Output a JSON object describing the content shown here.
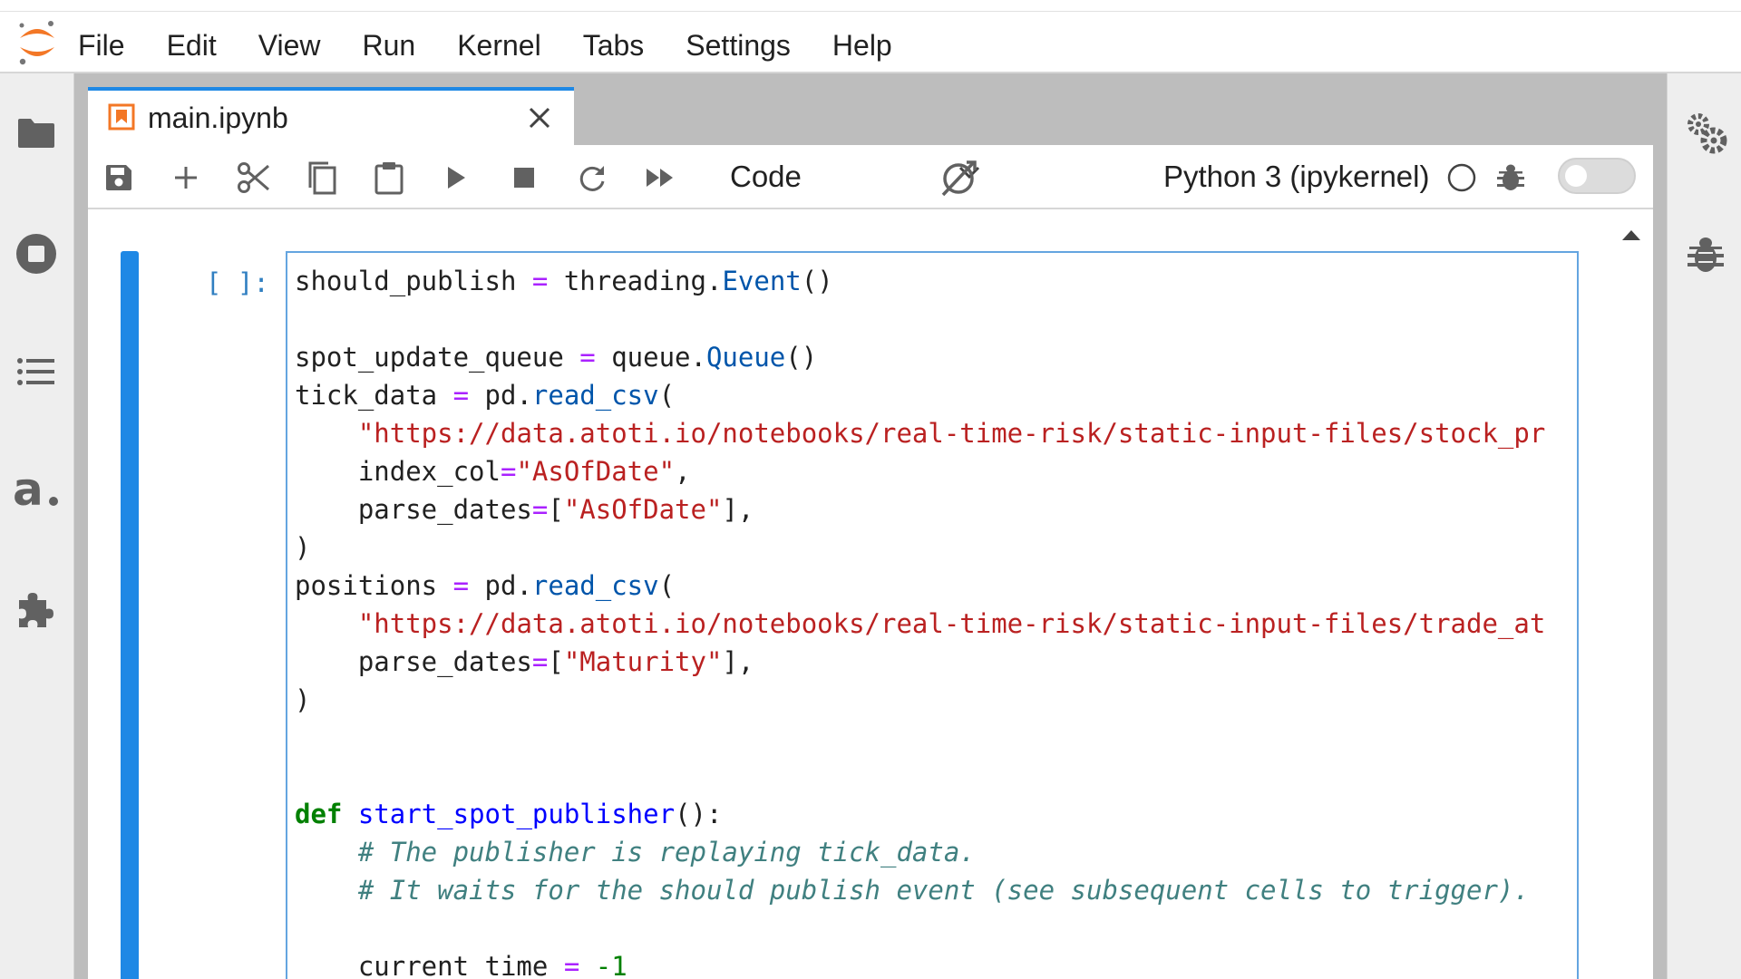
{
  "menu": {
    "items": [
      "File",
      "Edit",
      "View",
      "Run",
      "Kernel",
      "Tabs",
      "Settings",
      "Help"
    ]
  },
  "left_sidebar": {
    "icons": [
      "folder-icon",
      "running-stop-icon",
      "table-of-contents-icon",
      "atoti-icon",
      "extension-puzzle-icon"
    ]
  },
  "right_sidebar": {
    "icons": [
      "property-inspector-gears-icon",
      "debugger-bug-icon"
    ]
  },
  "tab": {
    "label": "main.ipynb"
  },
  "toolbar": {
    "cell_type": "Code",
    "kernel_name": "Python 3 (ipykernel)",
    "kernel_status": "idle",
    "debugger_enabled": false
  },
  "cell": {
    "prompt": "[ ]:",
    "lines": [
      [
        [
          "should_publish ",
          ""
        ],
        [
          "=",
          "op"
        ],
        [
          " threading.",
          ""
        ],
        [
          "Event",
          "fn"
        ],
        [
          "()",
          ""
        ]
      ],
      [],
      [
        [
          "spot_update_queue ",
          ""
        ],
        [
          "=",
          "op"
        ],
        [
          " queue.",
          ""
        ],
        [
          "Queue",
          "fn"
        ],
        [
          "()",
          ""
        ]
      ],
      [
        [
          "tick_data ",
          ""
        ],
        [
          "=",
          "op"
        ],
        [
          " pd.",
          ""
        ],
        [
          "read_csv",
          "fn"
        ],
        [
          "(",
          ""
        ]
      ],
      [
        [
          "    ",
          ""
        ],
        [
          "\"https://data.atoti.io/notebooks/real-time-risk/static-input-files/stock_pr",
          "str"
        ]
      ],
      [
        [
          "    index_col",
          ""
        ],
        [
          "=",
          "op"
        ],
        [
          "\"AsOfDate\"",
          "str"
        ],
        [
          ",",
          ""
        ]
      ],
      [
        [
          "    parse_dates",
          ""
        ],
        [
          "=",
          "op"
        ],
        [
          "[",
          ""
        ],
        [
          "\"AsOfDate\"",
          "str"
        ],
        [
          "],",
          ""
        ]
      ],
      [
        [
          ")",
          ""
        ]
      ],
      [
        [
          "positions ",
          ""
        ],
        [
          "=",
          "op"
        ],
        [
          " pd.",
          ""
        ],
        [
          "read_csv",
          "fn"
        ],
        [
          "(",
          ""
        ]
      ],
      [
        [
          "    ",
          ""
        ],
        [
          "\"https://data.atoti.io/notebooks/real-time-risk/static-input-files/trade_at",
          "str"
        ]
      ],
      [
        [
          "    parse_dates",
          ""
        ],
        [
          "=",
          "op"
        ],
        [
          "[",
          ""
        ],
        [
          "\"Maturity\"",
          "str"
        ],
        [
          "],",
          ""
        ]
      ],
      [
        [
          ")",
          ""
        ]
      ],
      [],
      [],
      [
        [
          "def",
          "kw"
        ],
        [
          " ",
          ""
        ],
        [
          "start_spot_publisher",
          "def"
        ],
        [
          "():",
          ""
        ]
      ],
      [
        [
          "    ",
          ""
        ],
        [
          "# The publisher is replaying tick_data.",
          "com"
        ]
      ],
      [
        [
          "    ",
          ""
        ],
        [
          "# It waits for the should publish event (see subsequent cells to trigger).",
          "com"
        ]
      ],
      [],
      [
        [
          "    current_time ",
          ""
        ],
        [
          "=",
          "op"
        ],
        [
          " ",
          ""
        ],
        [
          "-1",
          "num"
        ]
      ]
    ]
  },
  "colors": {
    "accent": "#1e88e5",
    "string": "#ba2121",
    "keyword": "#008000",
    "function": "#0055aa",
    "operator": "#aa22ff",
    "comment": "#408080",
    "logo_orange": "#f37726"
  }
}
